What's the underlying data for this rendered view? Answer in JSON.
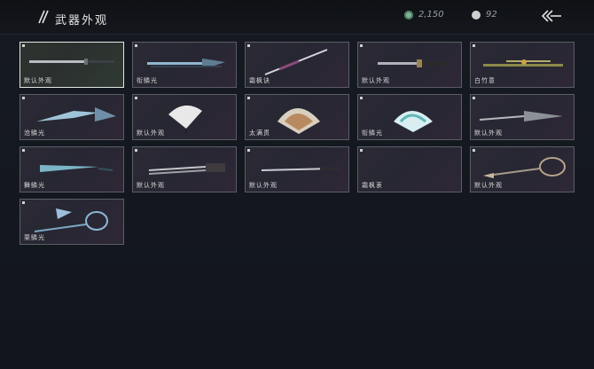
{
  "header": {
    "title": "武器外观",
    "jade_currency": "2,150",
    "pearl_currency": "92"
  },
  "items": [
    {
      "label": "默认外观",
      "icon": "long-sword-icon"
    },
    {
      "label": "衔鳞光",
      "icon": "blue-sword-icon"
    },
    {
      "label": "霜枫诀",
      "icon": "thin-sword-icon"
    },
    {
      "label": "默认外观",
      "icon": "gold-sword-icon"
    },
    {
      "label": "白竹意",
      "icon": "bamboo-sword-icon"
    },
    {
      "label": "沧鳞光",
      "icon": "crystal-blade-icon"
    },
    {
      "label": "默认外观",
      "icon": "white-fan-icon"
    },
    {
      "label": "太满贯",
      "icon": "patterned-fan-icon"
    },
    {
      "label": "衔鳞光",
      "icon": "teal-fan-icon"
    },
    {
      "label": "默认外观",
      "icon": "umbrella-spear-icon"
    },
    {
      "label": "舞鳞光",
      "icon": "umbrella-icon"
    },
    {
      "label": "默认外观",
      "icon": "twin-sabres-icon"
    },
    {
      "label": "默认外观",
      "icon": "long-sabre-icon"
    },
    {
      "label": "霜枫衷",
      "icon": "empty-slot-icon"
    },
    {
      "label": "默认外观",
      "icon": "rope-dart-icon"
    },
    {
      "label": "栗鳞光",
      "icon": "chain-whip-icon"
    }
  ]
}
